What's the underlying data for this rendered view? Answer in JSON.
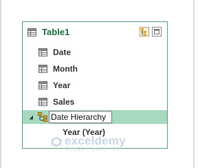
{
  "table": {
    "title": "Table1",
    "fields": [
      {
        "label": "Date",
        "icon": "table-icon"
      },
      {
        "label": "Month",
        "icon": "table-icon"
      },
      {
        "label": "Year",
        "icon": "table-icon"
      },
      {
        "label": "Sales",
        "icon": "table-icon"
      }
    ],
    "hierarchy": {
      "name": "Date Hierarchy",
      "icon": "hierarchy-icon",
      "expanded": true,
      "levels": [
        {
          "label": "Year (Year)"
        }
      ]
    },
    "header_buttons": [
      {
        "icon": "create-hierarchy-icon"
      },
      {
        "icon": "maximize-icon"
      }
    ]
  },
  "colors": {
    "accent": "#1f6b44",
    "border": "#5a9c78",
    "selection": "#a7d9bf"
  },
  "watermark": {
    "name": "exceldemy",
    "tagline": "EXCEL · DATA · BI"
  }
}
